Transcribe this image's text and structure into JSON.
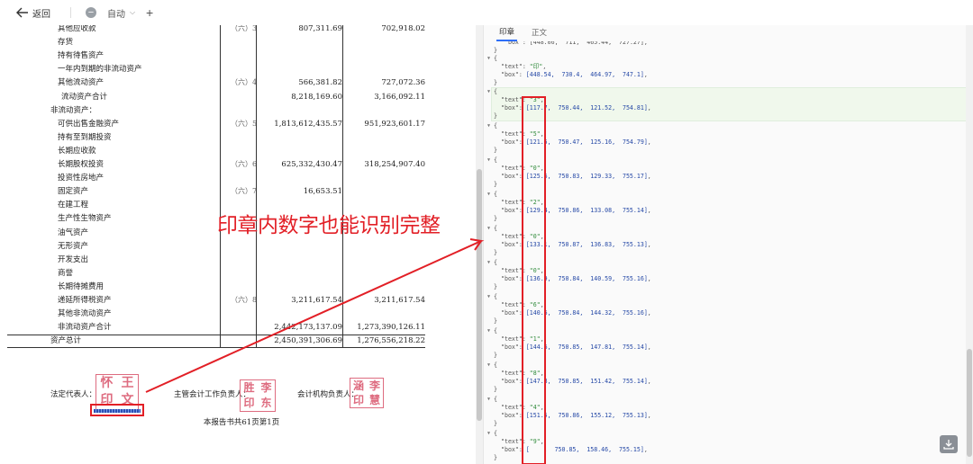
{
  "toolbar": {
    "back_label": "返回",
    "zoom_label": "自动",
    "zoom_out_glyph": "−",
    "zoom_in_glyph": "+"
  },
  "document": {
    "rows": [
      {
        "label": "其他应收款",
        "indent": 1,
        "note": "（六）3",
        "v1": "807,311.69",
        "v2": "702,918.02"
      },
      {
        "label": "存货",
        "indent": 1,
        "note": "",
        "v1": "",
        "v2": ""
      },
      {
        "label": "持有待售资产",
        "indent": 1,
        "note": "",
        "v1": "",
        "v2": ""
      },
      {
        "label": "一年内到期的非流动资产",
        "indent": 1,
        "note": "",
        "v1": "",
        "v2": ""
      },
      {
        "label": "其他流动资产",
        "indent": 1,
        "note": "（六）4",
        "v1": "566,381.82",
        "v2": "727,072.36"
      },
      {
        "label": "流动资产合计",
        "indent": 2,
        "note": "",
        "v1": "8,218,169.60",
        "v2": "3,166,092.11"
      },
      {
        "label": "非流动资产：",
        "indent": 0,
        "note": "",
        "v1": "",
        "v2": ""
      },
      {
        "label": "可供出售金融资产",
        "indent": 1,
        "note": "（六）5",
        "v1": "1,813,612,435.57",
        "v2": "951,923,601.17"
      },
      {
        "label": "持有至到期投资",
        "indent": 1,
        "note": "",
        "v1": "",
        "v2": ""
      },
      {
        "label": "长期应收款",
        "indent": 1,
        "note": "",
        "v1": "",
        "v2": ""
      },
      {
        "label": "长期股权投资",
        "indent": 1,
        "note": "（六）6",
        "v1": "625,332,430.47",
        "v2": "318,254,907.40"
      },
      {
        "label": "投资性房地产",
        "indent": 1,
        "note": "",
        "v1": "",
        "v2": ""
      },
      {
        "label": "固定资产",
        "indent": 1,
        "note": "（六）7",
        "v1": "16,653.51",
        "v2": ""
      },
      {
        "label": "在建工程",
        "indent": 1,
        "note": "",
        "v1": "",
        "v2": ""
      },
      {
        "label": "生产性生物资产",
        "indent": 1,
        "note": "",
        "v1": "",
        "v2": ""
      },
      {
        "label": "油气资产",
        "indent": 1,
        "note": "",
        "v1": "",
        "v2": ""
      },
      {
        "label": "无形资产",
        "indent": 1,
        "note": "",
        "v1": "",
        "v2": ""
      },
      {
        "label": "开发支出",
        "indent": 1,
        "note": "",
        "v1": "",
        "v2": ""
      },
      {
        "label": "商誉",
        "indent": 1,
        "note": "",
        "v1": "",
        "v2": ""
      },
      {
        "label": "长期待摊费用",
        "indent": 1,
        "note": "",
        "v1": "",
        "v2": ""
      },
      {
        "label": "递延所得税资产",
        "indent": 1,
        "note": "（六）8",
        "v1": "3,211,617.54",
        "v2": "3,211,617.54"
      },
      {
        "label": "其他非流动资产",
        "indent": 1,
        "note": "",
        "v1": "",
        "v2": ""
      },
      {
        "label": "非流动资产合计",
        "indent": 1,
        "note": "",
        "v1": "2,442,173,137.09",
        "v2": "1,273,390,126.11"
      },
      {
        "label": "资产总计",
        "indent": 0,
        "note": "",
        "v1": "2,450,391,306.69",
        "v2": "1,276,556,218.22"
      }
    ],
    "signers": {
      "legal_rep": "法定代表人：",
      "accounting_head": "主管会计工作负责人：",
      "agency_head": "会计机构负责人："
    },
    "seals": {
      "legal": [
        "怀",
        "王",
        "印",
        "文"
      ],
      "accounting": [
        "胜",
        "李",
        "印",
        "东"
      ],
      "agency": [
        "涵",
        "李",
        "印",
        "慧"
      ]
    },
    "footer": "本报告书共61页第1页"
  },
  "right_panel": {
    "tabs": [
      {
        "label": "印章",
        "active": true
      },
      {
        "label": "正文",
        "active": false
      }
    ],
    "top_partial": "\"box\": [448.06,  711,  465.44,  727.27],",
    "entries": [
      {
        "text": "印",
        "box": "[448.54,  730.4,  464.97,  747.1]"
      },
      {
        "text": "3",
        "box": "[117.7,  750.44,  121.52,  754.81]"
      },
      {
        "text": "5",
        "box": "[121.5,  750.47,  125.16,  754.79]"
      },
      {
        "text": "0",
        "box": "[125.6,  750.83,  129.33,  755.17]"
      },
      {
        "text": "2",
        "box": "[129.4,  750.86,  133.08,  755.14]"
      },
      {
        "text": "0",
        "box": "[133.1,  750.87,  136.83,  755.13]"
      },
      {
        "text": "0",
        "box": "[136.9,  750.84,  140.59,  755.16]"
      },
      {
        "text": "6",
        "box": "[140.6,  750.84,  144.32,  755.16]"
      },
      {
        "text": "1",
        "box": "[144.6,  750.85,  147.81,  755.14]"
      },
      {
        "text": "8",
        "box": "[147.8,  750.85,  151.42,  755.14]"
      },
      {
        "text": "4",
        "box": "[151.5,  750.86,  155.12,  755.13]"
      },
      {
        "text": "9",
        "box": "[    ,  750.85,  158.46,  755.15]"
      }
    ]
  },
  "annotation": {
    "text": "印章内数字也能识别完整",
    "color": "#e21f26"
  },
  "colors": {
    "accent": "#2e6ef7",
    "annotation": "#e21f26",
    "seal": "#d9536a",
    "json_string": "#2f8a3a",
    "json_number": "#2548a6"
  }
}
